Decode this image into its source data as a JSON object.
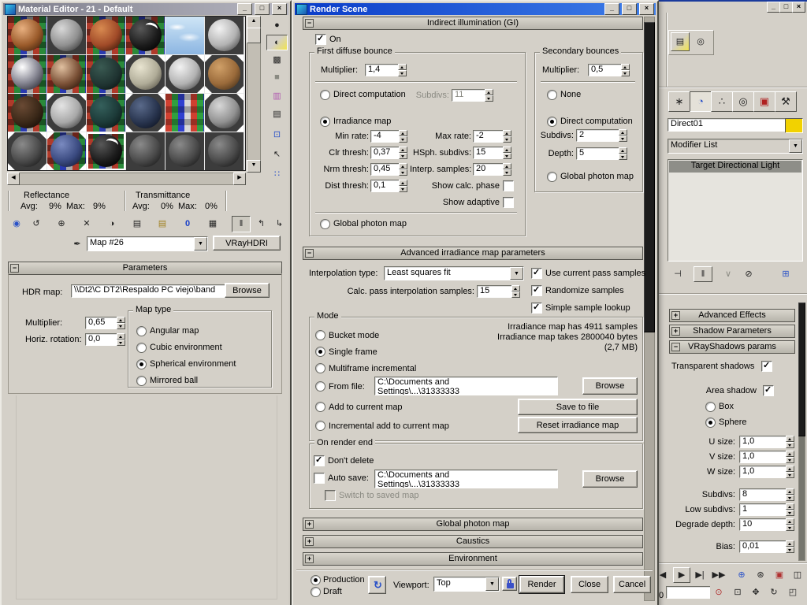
{
  "icons": {
    "min": "_",
    "max": "□",
    "close": "×",
    "up": "▲",
    "down": "▼",
    "left": "◀",
    "right": "▶",
    "drop": "▼",
    "pick": "✒",
    "get-material": "◉",
    "put-to-scene": "↺",
    "assign-to-selection": "⊕",
    "reset-map": "✕",
    "make-unique": "◑",
    "put-to-library": "▤",
    "material-id": "0",
    "show-map-in-viewport": "▦",
    "show-end-result": "‖",
    "go-to-parent": "↰",
    "go-forward-sibling": "↳",
    "sample-type": "●",
    "backlight": "◐",
    "background": "▩",
    "sample-uv-tiling": "■",
    "video-color-check": "▥",
    "make-preview": "▤",
    "options": "⊡",
    "select-by-material": "↖",
    "material-map-navigator": "∷",
    "tab-create": "∗",
    "tab-modify": "◔",
    "tab-hierarchy": "∴",
    "tab-motion": "◎",
    "tab-display": "▣",
    "tab-utilities": "⚒",
    "pin-stack": "⊣",
    "stack-show-end-result": "‖",
    "stack-make-unique": "∨",
    "remove-modifier": "⊘",
    "configure-modifier-sets": "⊞",
    "play": "▶",
    "next-frame": "▶|",
    "go-end": "▶▶",
    "zoom": "⊕",
    "zoom-all": "⊛",
    "zoom-extents": "▣",
    "zoom-extents-all": "◫",
    "time-config": "⊙",
    "region-zoom": "⊡",
    "pan": "✥",
    "arc-rotate": "↻",
    "minmax-toggle": "◰",
    "preset": "↻",
    "prev": "◀",
    "toolbar-a": "▤",
    "toolbar-b": "◎"
  },
  "material_editor": {
    "title": "Material Editor - 21 - Default",
    "slots": [
      {
        "bg": "rgb",
        "ball": "copper"
      },
      {
        "bg": "dark",
        "ball": "gray"
      },
      {
        "bg": "rgb",
        "ball": "rust"
      },
      {
        "bg": "rgb",
        "ball": "blackshine"
      },
      {
        "bg": "sky"
      },
      {
        "bg": "dark",
        "ball": "light"
      },
      {
        "bg": "rgb",
        "ball": "chrome"
      },
      {
        "bg": "rgb",
        "ball": "bronze"
      },
      {
        "bg": "rgb",
        "ball": "darkteal"
      },
      {
        "bg": "dark",
        "ball": "stone",
        "tri": true
      },
      {
        "bg": "dark",
        "ball": "light",
        "tri": true
      },
      {
        "bg": "dark",
        "ball": "wood",
        "tri": true
      },
      {
        "bg": "rgb",
        "ball": "darkbrown"
      },
      {
        "bg": "dark",
        "ball": "pale",
        "tri": true
      },
      {
        "bg": "rgb",
        "ball": "teal"
      },
      {
        "bg": "dark",
        "ball": "star",
        "tri": true
      },
      {
        "bg": "rgbflat"
      },
      {
        "bg": "dark",
        "ball": "gray",
        "tri": true
      },
      {
        "bg": "dark",
        "ball": "dark",
        "tri": true
      },
      {
        "bg": "rgb",
        "ball": "bluemix",
        "tri": true
      },
      {
        "bg": "rgb",
        "ball": "blackshine",
        "active": true
      },
      {
        "bg": "dark",
        "ball": "dark"
      },
      {
        "bg": "dark",
        "ball": "dark"
      },
      {
        "bg": "dark",
        "ball": "dark"
      }
    ],
    "stats": {
      "reflectance": "Reflectance",
      "transmittance": "Transmittance",
      "avg": "Avg:",
      "max": "Max:",
      "refl_avg": "9%",
      "refl_max": "9%",
      "trans_avg": "0%",
      "trans_max": "0%"
    },
    "map_name": "Map #26",
    "type_button": "VRayHDRI",
    "params": {
      "header": "Parameters",
      "hdr_label": "HDR map:",
      "hdr_value": "\\\\Dt2\\C DT2\\Respaldo PC viejo\\band",
      "browse": "Browse",
      "multiplier_label": "Multiplier:",
      "multiplier": "0,65",
      "rotation_label": "Horiz. rotation:",
      "rotation": "0,0",
      "map_type_legend": "Map type",
      "map_type_options": [
        "Angular map",
        "Cubic environment",
        "Spherical environment",
        "Mirrored ball"
      ],
      "map_type_selected": 2
    }
  },
  "render_scene": {
    "title": "Render Scene",
    "gi": {
      "header": "Indirect illumination (GI)",
      "on": "On",
      "fdb": {
        "legend": "First diffuse bounce",
        "multiplier_label": "Multiplier:",
        "multiplier": "1,4",
        "direct": "Direct computation",
        "subdivs_label": "Subdivs:",
        "subdivs": "11",
        "irradiance": "Irradiance map",
        "min_rate_label": "Min rate:",
        "min_rate": "-4",
        "max_rate_label": "Max rate:",
        "max_rate": "-2",
        "clr_label": "Clr thresh:",
        "clr": "0,37",
        "hsph_label": "HSph. subdivs:",
        "hsph": "15",
        "nrm_label": "Nrm thresh:",
        "nrm": "0,45",
        "interp_label": "Interp. samples:",
        "interp": "20",
        "dist_label": "Dist thresh:",
        "dist": "0,1",
        "show_calc": "Show calc. phase",
        "show_adaptive": "Show adaptive",
        "global_photon": "Global photon map"
      },
      "sb": {
        "legend": "Secondary bounces",
        "multiplier_label": "Multiplier:",
        "multiplier": "0,5",
        "none": "None",
        "direct": "Direct computation",
        "subdivs_label": "Subdivs:",
        "subdivs": "2",
        "depth_label": "Depth:",
        "depth": "5",
        "global_photon": "Global photon map"
      }
    },
    "adv": {
      "header": "Advanced irradiance map parameters",
      "interp_label": "Interpolation type:",
      "interp_value": "Least squares fit",
      "use_current": "Use current pass samples",
      "calc_label": "Calc. pass interpolation samples:",
      "calc_value": "15",
      "randomize": "Randomize samples",
      "simple": "Simple sample lookup",
      "mode_legend": "Mode",
      "mode_options": [
        "Bucket mode",
        "Single frame",
        "Multiframe incremental",
        "From file:",
        "Add to current map",
        "Incremental add to current map"
      ],
      "mode_selected": 1,
      "path_line1": "C:\\Documents and",
      "path_line2": "Settings\\...\\31333333",
      "browse": "Browse",
      "save_to_file": "Save to file",
      "reset_map": "Reset irradiance map",
      "info1": "Irradiance map has 4911 samples",
      "info2": "Irradiance map takes 2800040 bytes",
      "info3": "(2,7 MB)",
      "ore_legend": "On render end",
      "dont_delete": "Don't delete",
      "auto_save": "Auto save:",
      "switch_saved": "Switch to saved map"
    },
    "rollouts": [
      "Global photon map",
      "Caustics",
      "Environment"
    ],
    "bottom": {
      "production": "Production",
      "draft": "Draft",
      "viewport_label": "Viewport:",
      "viewport": "Top",
      "render": "Render",
      "close": "Close",
      "cancel": "Cancel"
    }
  },
  "panel": {
    "object_name": "Direct01",
    "modifier_list": "Modifier List",
    "stack_item": "Target Directional Light",
    "rollout_advanced_effects": "Advanced Effects",
    "rollout_shadow_parameters": "Shadow Parameters",
    "rollout_vrayshadows": "VRayShadows params",
    "vs": {
      "transparent": "Transparent shadows",
      "area": "Area shadow",
      "box": "Box",
      "sphere": "Sphere",
      "fields": [
        {
          "label": "U size:",
          "value": "1,0"
        },
        {
          "label": "V size:",
          "value": "1,0"
        },
        {
          "label": "W size:",
          "value": "1,0"
        },
        {
          "label": "Subdivs:",
          "value": "8"
        },
        {
          "label": "Low subdivs:",
          "value": "1"
        },
        {
          "label": "Degrade depth:",
          "value": "10"
        },
        {
          "label": "Bias:",
          "value": "0,01"
        }
      ]
    },
    "frame_number": "0",
    "colors": {
      "swatch": "#f2d200"
    }
  }
}
